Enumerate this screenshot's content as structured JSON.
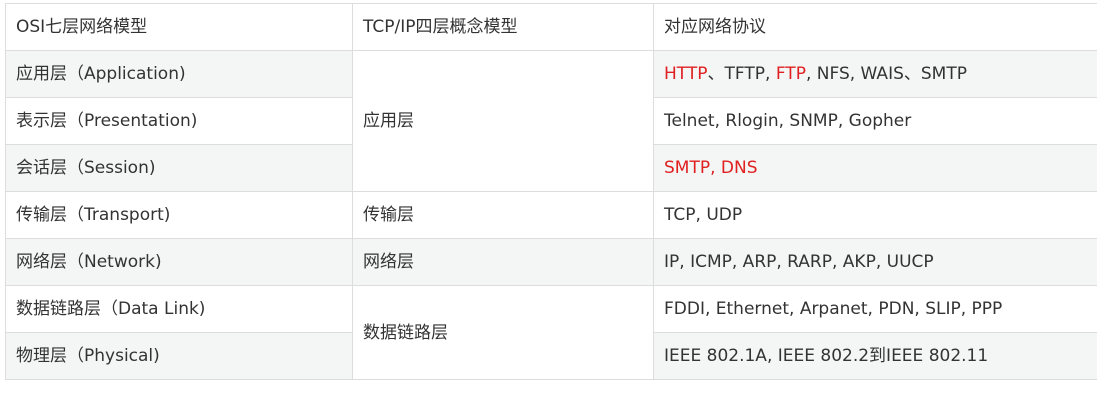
{
  "table": {
    "headers": [
      "OSI七层网络模型",
      "TCP/IP四层概念模型",
      "对应网络协议"
    ],
    "rows": [
      {
        "osi": "应用层（Application)",
        "tcpip": "应用层",
        "protocols": [
          {
            "text": "HTTP",
            "highlight": true
          },
          {
            "text": "、TFTP, ",
            "highlight": false
          },
          {
            "text": "FTP",
            "highlight": true
          },
          {
            "text": ", NFS, WAIS、SMTP",
            "highlight": false
          }
        ]
      },
      {
        "osi": "表示层（Presentation)",
        "protocols": [
          {
            "text": "Telnet, Rlogin, SNMP, Gopher",
            "highlight": false
          }
        ]
      },
      {
        "osi": "会话层（Session)",
        "protocols": [
          {
            "text": "SMTP, DNS",
            "highlight": true
          }
        ]
      },
      {
        "osi": "传输层（Transport)",
        "tcpip": "传输层",
        "protocols": [
          {
            "text": "TCP, UDP",
            "highlight": false
          }
        ]
      },
      {
        "osi": "网络层（Network)",
        "tcpip": "网络层",
        "protocols": [
          {
            "text": "IP, ICMP, ARP, RARP, AKP, UUCP",
            "highlight": false
          }
        ]
      },
      {
        "osi": "数据链路层（Data Link)",
        "tcpip": "数据链路层",
        "protocols": [
          {
            "text": "FDDI, Ethernet, Arpanet, PDN, SLIP, PPP",
            "highlight": false
          }
        ]
      },
      {
        "osi": "物理层（Physical)",
        "protocols": [
          {
            "text": "IEEE 802.1A, IEEE 802.2到IEEE 802.11",
            "highlight": false
          }
        ]
      }
    ]
  },
  "colors": {
    "highlight": "#e02020",
    "text": "#333333",
    "border": "#dddddd",
    "row_stripe": "#f4f5f5"
  }
}
